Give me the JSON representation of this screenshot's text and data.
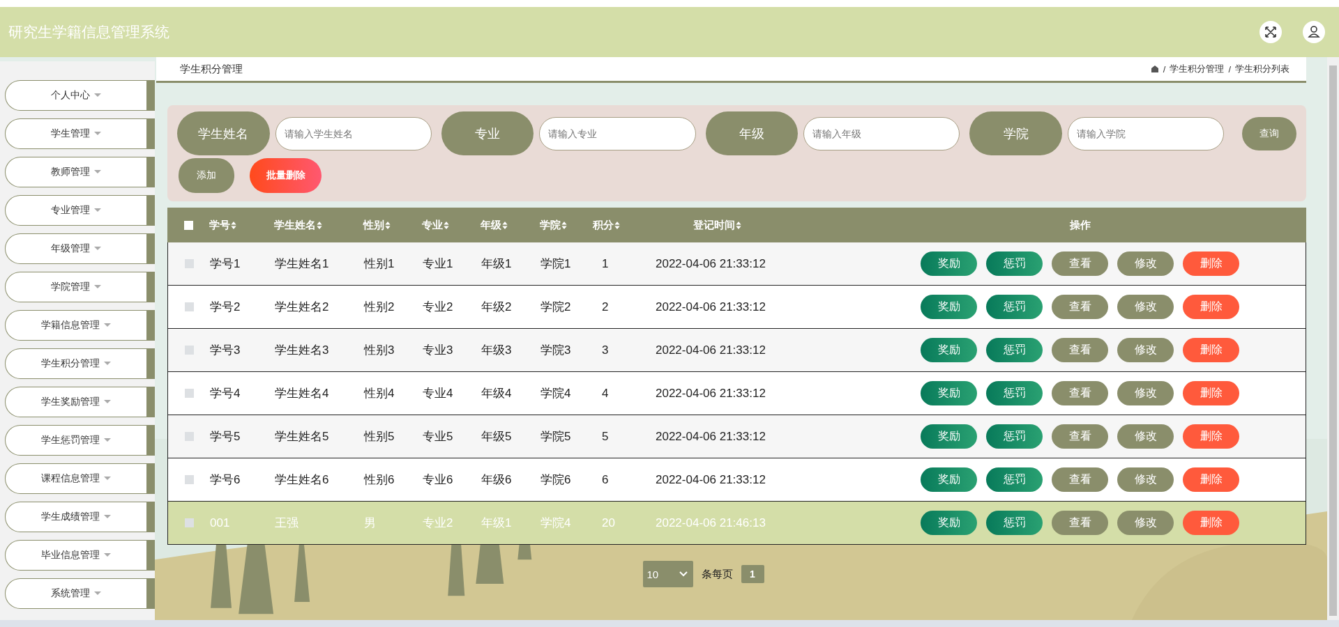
{
  "header": {
    "title": "研究生学籍信息管理系统"
  },
  "sidebar": {
    "items": [
      {
        "label": "个人中心"
      },
      {
        "label": "学生管理"
      },
      {
        "label": "教师管理"
      },
      {
        "label": "专业管理"
      },
      {
        "label": "年级管理"
      },
      {
        "label": "学院管理"
      },
      {
        "label": "学籍信息管理"
      },
      {
        "label": "学生积分管理"
      },
      {
        "label": "学生奖励管理"
      },
      {
        "label": "学生惩罚管理"
      },
      {
        "label": "课程信息管理"
      },
      {
        "label": "学生成绩管理"
      },
      {
        "label": "毕业信息管理"
      },
      {
        "label": "系统管理"
      }
    ]
  },
  "page_title": "学生积分管理",
  "breadcrumb": [
    {
      "separator": "/",
      "label": "学生积分管理"
    },
    {
      "separator": "/",
      "label": "学生积分列表"
    }
  ],
  "search": {
    "filters": [
      {
        "label": "学生姓名",
        "placeholder": "请输入学生姓名"
      },
      {
        "label": "专业",
        "placeholder": "请输入专业"
      },
      {
        "label": "年级",
        "placeholder": "请输入年级"
      },
      {
        "label": "学院",
        "placeholder": "请输入学院"
      }
    ],
    "query_button": "查询",
    "add_button": "添加",
    "batch_delete_button": "批量删除"
  },
  "table": {
    "select_all_checked": false,
    "columns": [
      "学号",
      "学生姓名",
      "性别",
      "专业",
      "年级",
      "学院",
      "积分",
      "登记时间",
      "操作"
    ],
    "rows": [
      {
        "checked": false,
        "selected": false,
        "cells": [
          "学号1",
          "学生姓名1",
          "性别1",
          "专业1",
          "年级1",
          "学院1",
          "1",
          "2022-04-06 21:33:12"
        ],
        "actions": [
          {
            "kind": "reward",
            "label": "奖励"
          },
          {
            "kind": "punish",
            "label": "惩罚"
          },
          {
            "kind": "view",
            "label": "查看"
          },
          {
            "kind": "edit",
            "label": "修改"
          },
          {
            "kind": "delete",
            "label": "删除"
          }
        ]
      },
      {
        "checked": false,
        "selected": false,
        "cells": [
          "学号2",
          "学生姓名2",
          "性别2",
          "专业2",
          "年级2",
          "学院2",
          "2",
          "2022-04-06 21:33:12"
        ],
        "actions": [
          {
            "kind": "reward",
            "label": "奖励"
          },
          {
            "kind": "punish",
            "label": "惩罚"
          },
          {
            "kind": "view",
            "label": "查看"
          },
          {
            "kind": "edit",
            "label": "修改"
          },
          {
            "kind": "delete",
            "label": "删除"
          }
        ]
      },
      {
        "checked": false,
        "selected": false,
        "cells": [
          "学号3",
          "学生姓名3",
          "性别3",
          "专业3",
          "年级3",
          "学院3",
          "3",
          "2022-04-06 21:33:12"
        ],
        "actions": [
          {
            "kind": "reward",
            "label": "奖励"
          },
          {
            "kind": "punish",
            "label": "惩罚"
          },
          {
            "kind": "view",
            "label": "查看"
          },
          {
            "kind": "edit",
            "label": "修改"
          },
          {
            "kind": "delete",
            "label": "删除"
          }
        ]
      },
      {
        "checked": false,
        "selected": false,
        "cells": [
          "学号4",
          "学生姓名4",
          "性别4",
          "专业4",
          "年级4",
          "学院4",
          "4",
          "2022-04-06 21:33:12"
        ],
        "actions": [
          {
            "kind": "reward",
            "label": "奖励"
          },
          {
            "kind": "punish",
            "label": "惩罚"
          },
          {
            "kind": "view",
            "label": "查看"
          },
          {
            "kind": "edit",
            "label": "修改"
          },
          {
            "kind": "delete",
            "label": "删除"
          }
        ]
      },
      {
        "checked": false,
        "selected": false,
        "cells": [
          "学号5",
          "学生姓名5",
          "性别5",
          "专业5",
          "年级5",
          "学院5",
          "5",
          "2022-04-06 21:33:12"
        ],
        "actions": [
          {
            "kind": "reward",
            "label": "奖励"
          },
          {
            "kind": "punish",
            "label": "惩罚"
          },
          {
            "kind": "view",
            "label": "查看"
          },
          {
            "kind": "edit",
            "label": "修改"
          },
          {
            "kind": "delete",
            "label": "删除"
          }
        ]
      },
      {
        "checked": false,
        "selected": false,
        "cells": [
          "学号6",
          "学生姓名6",
          "性别6",
          "专业6",
          "年级6",
          "学院6",
          "6",
          "2022-04-06 21:33:12"
        ],
        "actions": [
          {
            "kind": "reward",
            "label": "奖励"
          },
          {
            "kind": "punish",
            "label": "惩罚"
          },
          {
            "kind": "view",
            "label": "查看"
          },
          {
            "kind": "edit",
            "label": "修改"
          },
          {
            "kind": "delete",
            "label": "删除"
          }
        ]
      },
      {
        "checked": false,
        "selected": true,
        "cells": [
          "001",
          "王强",
          "男",
          "专业2",
          "年级1",
          "学院4",
          "20",
          "2022-04-06 21:46:13"
        ],
        "actions": [
          {
            "kind": "reward",
            "label": "奖励"
          },
          {
            "kind": "punish",
            "label": "惩罚"
          },
          {
            "kind": "view",
            "label": "查看"
          },
          {
            "kind": "edit",
            "label": "修改"
          },
          {
            "kind": "delete",
            "label": "删除"
          }
        ]
      }
    ]
  },
  "pagination": {
    "page_size": "10",
    "page_size_label": "条每页",
    "pages": [
      {
        "label": "1",
        "selected": true
      }
    ]
  }
}
